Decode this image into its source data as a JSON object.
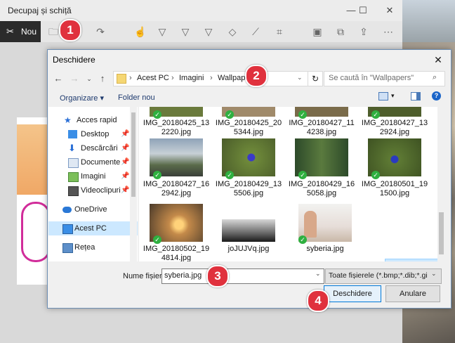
{
  "app": {
    "title": "Decupaj și schiță",
    "new_label": "Nou"
  },
  "dialog": {
    "title": "Deschidere",
    "breadcrumb": [
      "Acest PC",
      "Imagini",
      "Wallpapers"
    ],
    "search_placeholder": "Se caută în \"Wallpapers\"",
    "organize_label": "Organizare",
    "new_folder_label": "Folder nou",
    "nav": [
      {
        "label": "Acces rapid",
        "icon": "star-icon"
      },
      {
        "label": "Desktop",
        "icon": "desktop-icon",
        "pinned": true
      },
      {
        "label": "Descărcări",
        "icon": "download-icon",
        "pinned": true
      },
      {
        "label": "Documente",
        "icon": "document-icon",
        "pinned": true
      },
      {
        "label": "Imagini",
        "icon": "image-icon",
        "pinned": true
      },
      {
        "label": "Videoclipuri",
        "icon": "video-icon",
        "pinned": true
      },
      {
        "label": "OneDrive",
        "icon": "cloud-icon"
      },
      {
        "label": "Acest PC",
        "icon": "pc-icon"
      },
      {
        "label": "Rețea",
        "icon": "network-icon"
      }
    ],
    "files_row1": [
      "IMG_20180425_13\n2220.jpg",
      "IMG_20180425_20\n5344.jpg",
      "IMG_20180427_11\n4238.jpg",
      "IMG_20180427_13\n2924.jpg"
    ],
    "files_row2": [
      "IMG_20180427_16\n2942.jpg",
      "IMG_20180429_13\n5506.jpg",
      "IMG_20180429_16\n5058.jpg",
      "IMG_20180501_19\n1500.jpg"
    ],
    "files_row3": [
      "IMG_20180502_19\n4814.jpg",
      "joJUJVq.jpg",
      "syberia.jpg"
    ],
    "filename_label": "Nume fișier:",
    "filename_value": "syberia.jpg",
    "filetype_value": "Toate fișierele (*.bmp;*.dib;*.gif;*",
    "open_label": "Deschidere",
    "cancel_label": "Anulare"
  },
  "markers": [
    "1",
    "2",
    "3",
    "4"
  ],
  "colors": {
    "accent": "#0078d7",
    "marker": "#e0313d",
    "check": "#2fb040"
  }
}
